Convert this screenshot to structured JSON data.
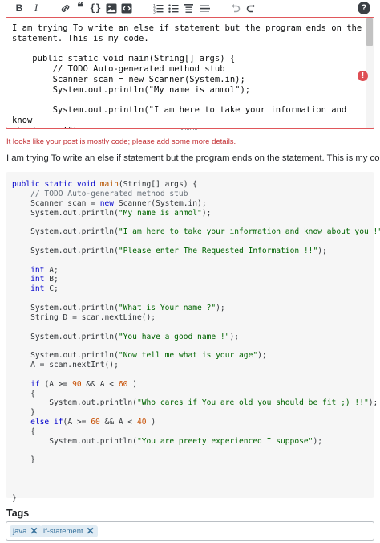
{
  "toolbar": {
    "bold_label": "B",
    "italic_label": "I",
    "quote_label": "❝",
    "code_label": "{}",
    "help_label": "?"
  },
  "editor": {
    "lines": [
      "I am trying To write an else if statement but the program ends on the",
      "statement. This is my code.",
      "",
      "    public static void main(String[] args) {",
      "        // TODO Auto-generated method stub",
      "        Scanner scan = new Scanner(System.in);",
      "        System.out.println(\"My name is anmol\");",
      "",
      "        System.out.println(\"I am here to take your information and know",
      "about you !\");"
    ],
    "error_label": "!"
  },
  "warning": "It looks like your post is mostly code; please add some more details.",
  "preview": {
    "paragraph": "I am trying To write an else if statement but the program ends on the statement. This is my code.",
    "code_lines": [
      [
        [
          "kw",
          "public "
        ],
        [
          "kw",
          "static "
        ],
        [
          "kt",
          "void "
        ],
        [
          "fn",
          "main"
        ],
        [
          "",
          "(String[] args) {"
        ]
      ],
      [
        [
          "cmt",
          "    // TODO Auto-generated method stub"
        ]
      ],
      [
        [
          "",
          "    Scanner scan = "
        ],
        [
          "kw",
          "new "
        ],
        [
          "",
          "Scanner(System.in);"
        ]
      ],
      [
        [
          "",
          "    System.out.println("
        ],
        [
          "str",
          "\"My name is anmol\""
        ],
        [
          "",
          ");"
        ]
      ],
      [],
      [
        [
          "",
          "    System.out.println("
        ],
        [
          "str",
          "\"I am here to take your information and know about you !\""
        ],
        [
          "",
          ");"
        ]
      ],
      [],
      [
        [
          "",
          "    System.out.println("
        ],
        [
          "str",
          "\"Please enter The Requested Information !!\""
        ],
        [
          "",
          ");"
        ]
      ],
      [],
      [
        [
          "kt",
          "    int "
        ],
        [
          "",
          "A;"
        ]
      ],
      [
        [
          "kt",
          "    int "
        ],
        [
          "",
          "B;"
        ]
      ],
      [
        [
          "kt",
          "    int "
        ],
        [
          "",
          "C;"
        ]
      ],
      [],
      [
        [
          "",
          "    System.out.println("
        ],
        [
          "str",
          "\"What is Your name ?\""
        ],
        [
          "",
          ");"
        ]
      ],
      [
        [
          "",
          "    String D = scan.nextLine();"
        ]
      ],
      [],
      [
        [
          "",
          "    System.out.println("
        ],
        [
          "str",
          "\"You have a good name !\""
        ],
        [
          "",
          ");"
        ]
      ],
      [],
      [
        [
          "",
          "    System.out.println("
        ],
        [
          "str",
          "\"Now tell me what is your age\""
        ],
        [
          "",
          ");"
        ]
      ],
      [
        [
          "",
          "    A = scan.nextInt();"
        ]
      ],
      [],
      [
        [
          "kw",
          "    if "
        ],
        [
          "",
          "(A >= "
        ],
        [
          "num",
          "90"
        ],
        [
          "",
          " && A < "
        ],
        [
          "num",
          "60"
        ],
        [
          "",
          " )"
        ]
      ],
      [
        [
          "",
          "    {"
        ]
      ],
      [
        [
          "",
          "        System.out.println("
        ],
        [
          "str",
          "\"Who cares if You are old you should be fit ;) !!\""
        ],
        [
          "",
          ");"
        ]
      ],
      [
        [
          "",
          "    }"
        ]
      ],
      [
        [
          "kw",
          "    else if"
        ],
        [
          "",
          "(A >= "
        ],
        [
          "num",
          "60"
        ],
        [
          "",
          " && A < "
        ],
        [
          "num",
          "40"
        ],
        [
          "",
          " )"
        ]
      ],
      [
        [
          "",
          "    {"
        ]
      ],
      [
        [
          "",
          "        System.out.println("
        ],
        [
          "str",
          "\"You are preety experienced I suppose\""
        ],
        [
          "",
          ");"
        ]
      ],
      [],
      [
        [
          "",
          "    }"
        ]
      ],
      [],
      [],
      [],
      [
        [
          "",
          "}"
        ]
      ]
    ]
  },
  "tags": {
    "label": "Tags",
    "items": [
      "java",
      "if-statement"
    ],
    "remove_label": "✕"
  },
  "colors": {
    "error": "#de4f54",
    "tag_bg": "#e1ecf4",
    "tag_fg": "#39739d"
  }
}
